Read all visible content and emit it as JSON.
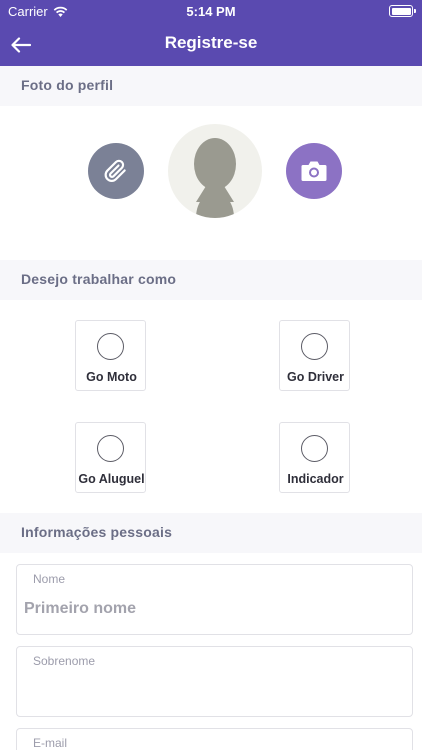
{
  "status_bar": {
    "carrier": "Carrier",
    "time": "5:14 PM"
  },
  "navbar": {
    "title": "Registre-se",
    "back_icon": "arrow-left-icon"
  },
  "profile_photo": {
    "section_title": "Foto do perfil",
    "attach_icon": "paperclip-icon",
    "camera_icon": "camera-icon",
    "avatar_icon": "person-silhouette-icon"
  },
  "work_type": {
    "section_title": "Desejo trabalhar como",
    "options": [
      {
        "label": "Go Moto",
        "selected": false
      },
      {
        "label": "Go Driver",
        "selected": false
      },
      {
        "label": "Go Aluguel",
        "selected": false
      },
      {
        "label": "Indicador",
        "selected": false
      }
    ]
  },
  "personal_info": {
    "section_title": "Informações pessoais",
    "fields": [
      {
        "label": "Nome",
        "value": "",
        "placeholder": "Primeiro nome"
      },
      {
        "label": "Sobrenome",
        "value": "",
        "placeholder": ""
      },
      {
        "label": "E-mail",
        "value": "",
        "placeholder": ""
      }
    ]
  },
  "colors": {
    "header": "#5a4ab0",
    "attach_button": "#7b8196",
    "camera_button": "#8c72c4",
    "section_header_bg": "#f7f7fa",
    "section_header_text": "#6b6e86"
  }
}
